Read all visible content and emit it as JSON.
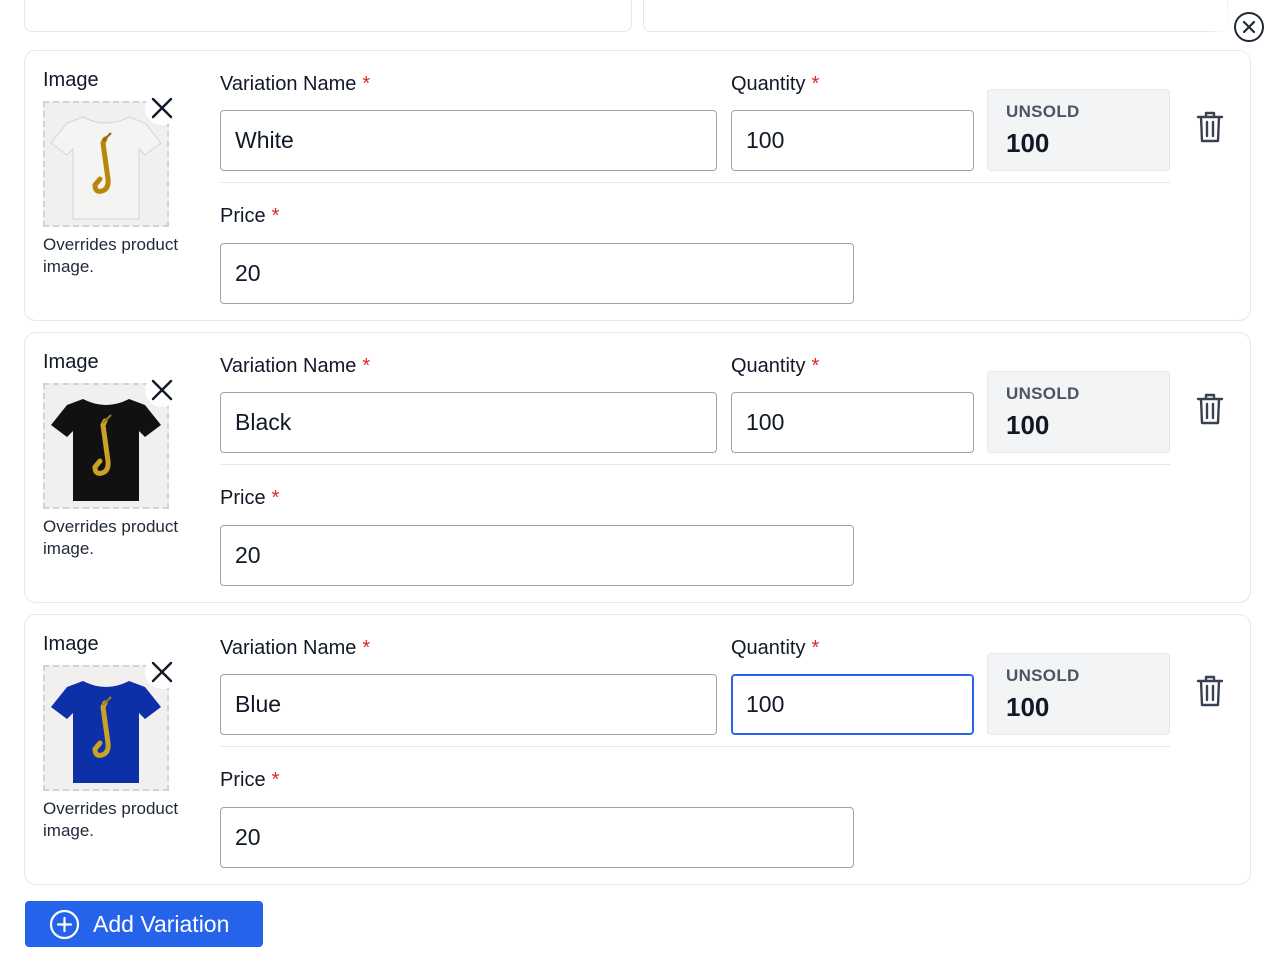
{
  "form": {
    "image_label": "Image",
    "image_hint": "Overrides product image.",
    "name_label": "Variation Name",
    "quantity_label": "Quantity",
    "price_label": "Price",
    "required_mark": "*",
    "unsold_label": "UNSOLD"
  },
  "variations": [
    {
      "name": "White",
      "quantity": "100",
      "unsold": "100",
      "price": "20",
      "shirt_color": "#f4f4f2"
    },
    {
      "name": "Black",
      "quantity": "100",
      "unsold": "100",
      "price": "20",
      "shirt_color": "#111111"
    },
    {
      "name": "Blue",
      "quantity": "100",
      "unsold": "100",
      "price": "20",
      "shirt_color": "#0d2fa8"
    }
  ],
  "actions": {
    "add_variation": "Add Variation"
  },
  "colors": {
    "primary": "#2563eb",
    "required": "#dc2626",
    "unsold_bg": "#f3f4f6"
  }
}
